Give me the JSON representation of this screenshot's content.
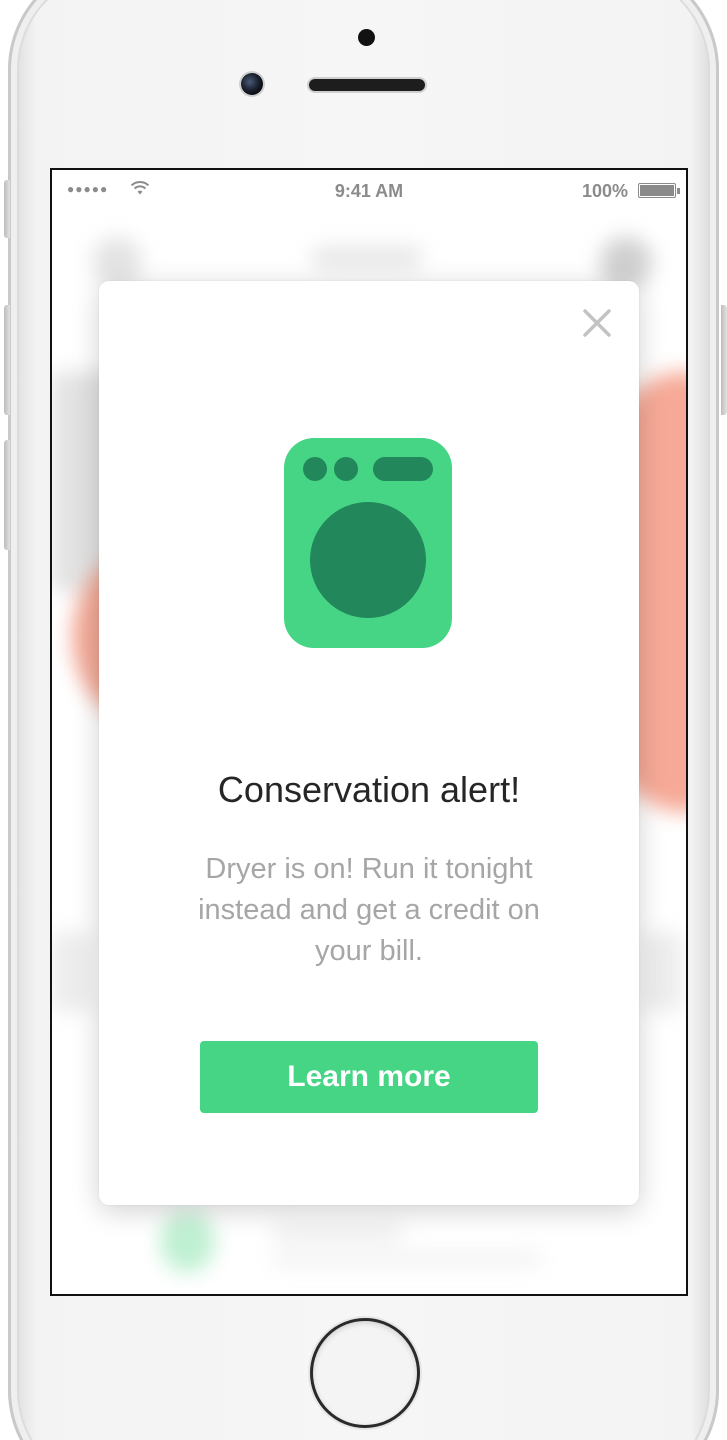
{
  "status_bar": {
    "signal": "●●●●●",
    "time": "9:41 AM",
    "battery": "100%"
  },
  "modal": {
    "close_icon": "close-icon",
    "illustration_icon": "dryer-icon",
    "title": "Conservation alert!",
    "message": "Dryer is on! Run it tonight instead and get a credit on your bill.",
    "button_label": "Learn more"
  },
  "colors": {
    "accent_green": "#45d584",
    "dryer_body": "#45d584",
    "dryer_detail": "#22885c",
    "title_text": "#262626",
    "message_text": "#a6a6a6",
    "status_text": "#8b8b8b",
    "background_highlight": "#f6a996"
  }
}
